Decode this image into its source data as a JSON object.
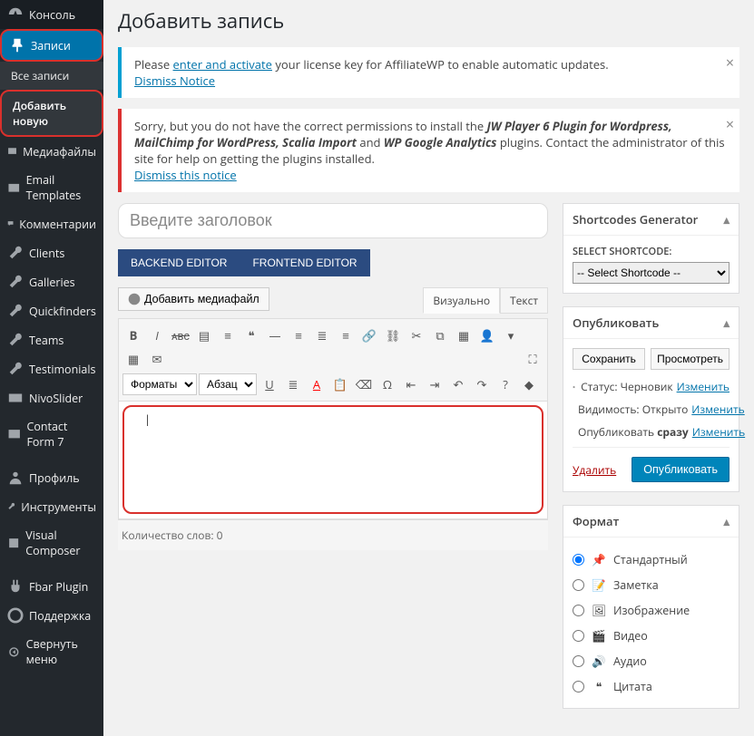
{
  "page_title": "Добавить запись",
  "sidebar": [
    {
      "key": "console",
      "label": "Консоль",
      "icon": "gauge"
    },
    {
      "key": "posts",
      "label": "Записи",
      "icon": "pin",
      "active": true,
      "highlight": true
    },
    {
      "key": "all",
      "label": "Все записи",
      "sub": true
    },
    {
      "key": "new",
      "label": "Добавить новую",
      "sub": true,
      "current": true,
      "highlight": true
    },
    {
      "key": "media",
      "label": "Медиафайлы",
      "icon": "image"
    },
    {
      "key": "email",
      "label": "Email Templates",
      "icon": "envelope"
    },
    {
      "key": "comments",
      "label": "Комментарии",
      "icon": "comment"
    },
    {
      "key": "clients",
      "label": "Clients",
      "icon": "wrench"
    },
    {
      "key": "galleries",
      "label": "Galleries",
      "icon": "wrench"
    },
    {
      "key": "quickfinders",
      "label": "Quickfinders",
      "icon": "wrench"
    },
    {
      "key": "teams",
      "label": "Teams",
      "icon": "wrench"
    },
    {
      "key": "testimonials",
      "label": "Testimonials",
      "icon": "wrench"
    },
    {
      "key": "nivo",
      "label": "NivoSlider",
      "icon": "slider"
    },
    {
      "key": "cf7",
      "label": "Contact Form 7",
      "icon": "envelope"
    },
    {
      "key": "sep1",
      "sep": true
    },
    {
      "key": "profile",
      "label": "Профиль",
      "icon": "user"
    },
    {
      "key": "tools",
      "label": "Инструменты",
      "icon": "wrench"
    },
    {
      "key": "vc",
      "label": "Visual Composer",
      "icon": "vc"
    },
    {
      "key": "sep2",
      "sep": true
    },
    {
      "key": "fbar",
      "label": "Fbar Plugin",
      "icon": "plugin"
    },
    {
      "key": "support",
      "label": "Поддержка",
      "icon": "life"
    },
    {
      "key": "collapse",
      "label": "Свернуть меню",
      "icon": "collapse"
    }
  ],
  "notices": {
    "license": {
      "prefix": "Please ",
      "link": "enter and activate",
      "suffix": " your license key for AffiliateWP to enable automatic updates.",
      "dismiss": "Dismiss Notice"
    },
    "perm": {
      "t1": "Sorry, but you do not have the correct permissions to install the ",
      "b": "JW Player 6 Plugin for Wordpress, MailChimp for WordPress, Scalia Import",
      "and": " and ",
      "b2": "WP Google Analytics",
      "t2": " plugins. Contact the administrator of this site for help on getting the plugins installed.",
      "dismiss": "Dismiss this notice"
    }
  },
  "title_placeholder": "Введите заголовок",
  "editor_switch": {
    "backend": "BACKEND EDITOR",
    "frontend": "FRONTEND EDITOR"
  },
  "media_button": "Добавить медиафайл",
  "editor_tabs": {
    "visual": "Визуально",
    "text": "Текст"
  },
  "format_select": "Форматы",
  "para_select": "Абзац",
  "wordcount": "Количество слов: 0",
  "boxes": {
    "shortcodes": {
      "title": "Shortcodes Generator",
      "label": "SELECT SHORTCODE:",
      "placeholder": "-- Select Shortcode --"
    },
    "publish": {
      "title": "Опубликовать",
      "save": "Сохранить",
      "preview": "Просмотреть",
      "status_label": "Статус:",
      "status_val": "Черновик",
      "edit": "Изменить",
      "vis_label": "Видимость:",
      "vis_val": "Открыто",
      "sched_label": "Опубликовать",
      "sched_val": "сразу",
      "delete": "Удалить",
      "publish": "Опубликовать"
    },
    "format": {
      "title": "Формат",
      "items": [
        {
          "k": "standard",
          "label": "Стандартный",
          "checked": true
        },
        {
          "k": "aside",
          "label": "Заметка"
        },
        {
          "k": "image",
          "label": "Изображение"
        },
        {
          "k": "video",
          "label": "Видео"
        },
        {
          "k": "audio",
          "label": "Аудио"
        },
        {
          "k": "quote",
          "label": "Цитата"
        }
      ]
    }
  }
}
